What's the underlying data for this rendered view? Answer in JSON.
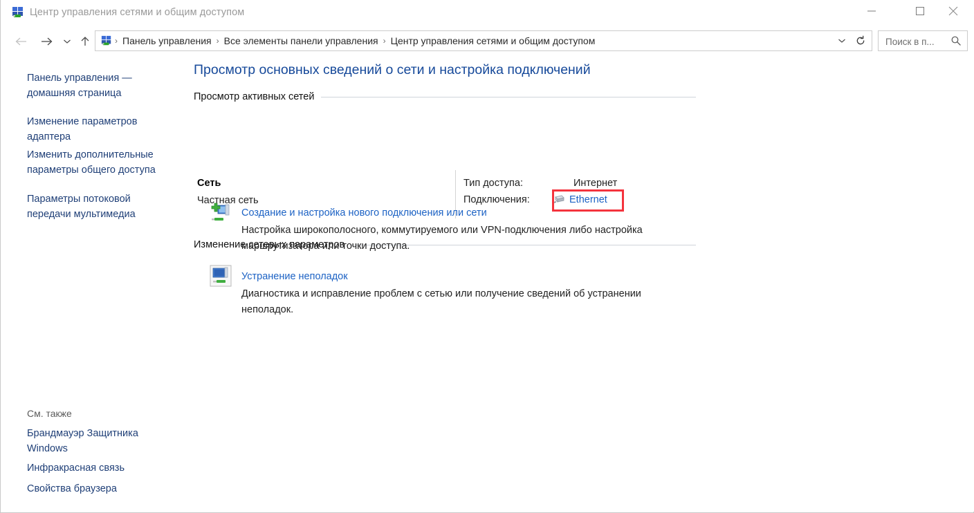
{
  "window": {
    "title": "Центр управления сетями и общим доступом",
    "icon": "network-sharing-center-icon",
    "controls": {
      "minimize": "minimize-icon",
      "maximize": "maximize-icon",
      "close": "close-icon"
    }
  },
  "navbar": {
    "back": "back-arrow-icon",
    "forward": "forward-arrow-icon",
    "recent": "recent-locations-chevron-icon",
    "up": "up-arrow-icon",
    "refresh": "refresh-icon",
    "dropdown": "address-dropdown-chevron-icon",
    "breadcrumbs": [
      "Панель управления",
      "Все элементы панели управления",
      "Центр управления сетями и общим доступом"
    ],
    "separator": "›"
  },
  "search": {
    "placeholder": "Поиск в п...",
    "value": "",
    "icon": "search-icon"
  },
  "sidebar": {
    "items": [
      "Панель управления — домашняя страница",
      "Изменение параметров адаптера",
      "Изменить дополнительные параметры общего доступа",
      "Параметры потоковой передачи мультимедиа"
    ],
    "see_also_label": "См. также",
    "see_also_items": [
      "Брандмауэр Защитника Windows",
      "Инфракрасная связь",
      "Свойства браузера"
    ]
  },
  "main": {
    "page_title": "Просмотр основных сведений о сети и настройка подключений",
    "sections": [
      {
        "heading": "Просмотр активных сетей"
      },
      {
        "heading": "Изменение сетевых параметров"
      }
    ],
    "active_network": {
      "name": "Сеть",
      "type": "Частная сеть",
      "access_label": "Тип доступа:",
      "access_value": "Интернет",
      "connections_label": "Подключения:",
      "connection_name": "Ethernet",
      "connection_icon": "ethernet-adapter-icon",
      "highlight_color": "#f4333d"
    },
    "tasks": [
      {
        "icon": "new-connection-icon",
        "link": "Создание и настройка нового подключения или сети",
        "description": "Настройка широкополосного, коммутируемого или VPN-подключения либо настройка маршрутизатора или точки доступа."
      },
      {
        "icon": "troubleshoot-icon",
        "link": "Устранение неполадок",
        "description": "Диагностика и исправление проблем с сетью или получение сведений об устранении неполадок."
      }
    ]
  },
  "colors": {
    "title_link": "#16499a",
    "link": "#1c62c4",
    "sidebar_link": "#1f3f77",
    "highlight": "#f4333d",
    "rule": "#cfd4da"
  }
}
